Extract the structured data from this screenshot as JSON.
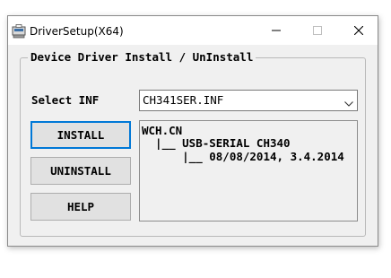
{
  "window": {
    "title": "DriverSetup(X64)",
    "icon": "driver-setup-app-icon"
  },
  "controls": {
    "minimize": "minimize-icon",
    "maximize": "maximize-icon",
    "close": "close-icon"
  },
  "group": {
    "title": "Device Driver Install / UnInstall"
  },
  "select_inf": {
    "label": "Select INF",
    "value": "CH341SER.INF"
  },
  "buttons": {
    "install": "INSTALL",
    "uninstall": "UNINSTALL",
    "help": "HELP"
  },
  "info": {
    "lines": [
      "WCH.CN",
      "  |__ USB-SERIAL CH340",
      "      |__ 08/08/2014, 3.4.2014"
    ]
  },
  "colors": {
    "focus_border": "#0078d7",
    "window_bg": "#f0f0f0",
    "button_bg": "#e1e1e1"
  }
}
